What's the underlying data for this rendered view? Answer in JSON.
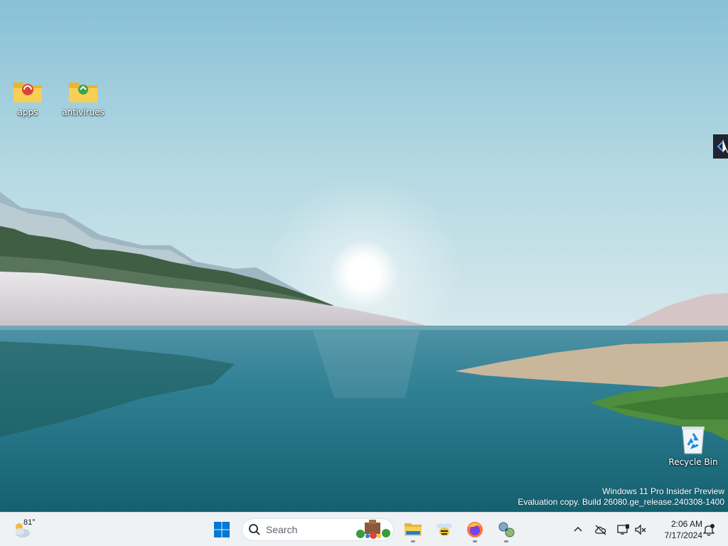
{
  "desktop": {
    "icons": [
      {
        "label": "apps",
        "icon": "folder-icon"
      },
      {
        "label": "antivirues",
        "icon": "folder-icon"
      },
      {
        "label": "Recycle Bin",
        "icon": "recycle-bin-icon"
      }
    ],
    "watermark": {
      "line1": "Windows 11 Pro Insider Preview",
      "line2": "Evaluation copy. Build 26080.ge_release.240308-1400"
    }
  },
  "taskbar": {
    "weather": {
      "temp": "81°",
      "icon": "weather-icon"
    },
    "start": {
      "icon": "windows-logo-icon"
    },
    "search": {
      "placeholder": "Search",
      "icon": "search-icon"
    },
    "pinned": [
      {
        "name": "File Explorer",
        "icon": "file-explorer-icon",
        "running": true
      },
      {
        "name": "bee app",
        "icon": "bee-icon",
        "running": false
      },
      {
        "name": "Firefox",
        "icon": "firefox-icon",
        "running": true
      },
      {
        "name": "network tool",
        "icon": "network-tool-icon",
        "running": true
      }
    ],
    "tray": {
      "icons": [
        "chevron-up-icon",
        "cloud-offline-icon",
        "monitor-icon",
        "volume-muted-icon"
      ],
      "time": "2:06 AM",
      "date": "7/17/2024",
      "notification_icon": "notification-bell-icon"
    }
  },
  "colors": {
    "sky_top": "#8cc3d8",
    "water": "#2f7f93",
    "taskbar": "#eef2f5",
    "windows_blue": "#0078d4"
  }
}
